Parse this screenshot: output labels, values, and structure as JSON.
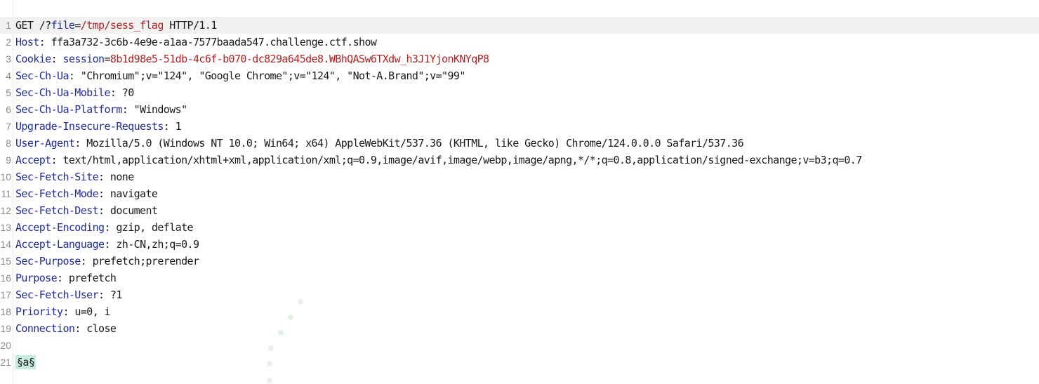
{
  "request": {
    "lines": [
      {
        "num": "1",
        "parts": [
          {
            "cls": "tok-val",
            "text": "GET /?"
          },
          {
            "cls": "tok-param",
            "text": "file"
          },
          {
            "cls": "tok-val",
            "text": "="
          },
          {
            "cls": "tok-red",
            "text": "/tmp/sess_flag"
          },
          {
            "cls": "tok-val",
            "text": " HTTP/1.1"
          }
        ]
      },
      {
        "num": "2",
        "parts": [
          {
            "cls": "tok-key",
            "text": "Host"
          },
          {
            "cls": "tok-sep",
            "text": ": "
          },
          {
            "cls": "tok-val",
            "text": "ffa3a732-3c6b-4e9e-a1aa-7577baada547.challenge.ctf.show"
          }
        ]
      },
      {
        "num": "3",
        "parts": [
          {
            "cls": "tok-key",
            "text": "Cookie"
          },
          {
            "cls": "tok-sep",
            "text": ": "
          },
          {
            "cls": "tok-param",
            "text": "session"
          },
          {
            "cls": "tok-val",
            "text": "="
          },
          {
            "cls": "tok-red",
            "text": "8b1d98e5-51db-4c6f-b070-dc829a645de8.WBhQASw6TXdw_h3J1YjonKNYqP8"
          }
        ]
      },
      {
        "num": "4",
        "parts": [
          {
            "cls": "tok-key",
            "text": "Sec-Ch-Ua"
          },
          {
            "cls": "tok-sep",
            "text": ": "
          },
          {
            "cls": "tok-val",
            "text": "\"Chromium\";v=\"124\", \"Google Chrome\";v=\"124\", \"Not-A.Brand\";v=\"99\""
          }
        ]
      },
      {
        "num": "5",
        "parts": [
          {
            "cls": "tok-key",
            "text": "Sec-Ch-Ua-Mobile"
          },
          {
            "cls": "tok-sep",
            "text": ": "
          },
          {
            "cls": "tok-val",
            "text": "?0"
          }
        ]
      },
      {
        "num": "6",
        "parts": [
          {
            "cls": "tok-key",
            "text": "Sec-Ch-Ua-Platform"
          },
          {
            "cls": "tok-sep",
            "text": ": "
          },
          {
            "cls": "tok-val",
            "text": "\"Windows\""
          }
        ]
      },
      {
        "num": "7",
        "parts": [
          {
            "cls": "tok-key",
            "text": "Upgrade-Insecure-Requests"
          },
          {
            "cls": "tok-sep",
            "text": ": "
          },
          {
            "cls": "tok-val",
            "text": "1"
          }
        ]
      },
      {
        "num": "8",
        "parts": [
          {
            "cls": "tok-key",
            "text": "User-Agent"
          },
          {
            "cls": "tok-sep",
            "text": ": "
          },
          {
            "cls": "tok-val",
            "text": "Mozilla/5.0 (Windows NT 10.0; Win64; x64) AppleWebKit/537.36 (KHTML, like Gecko) Chrome/124.0.0.0 Safari/537.36"
          }
        ]
      },
      {
        "num": "9",
        "parts": [
          {
            "cls": "tok-key",
            "text": "Accept"
          },
          {
            "cls": "tok-sep",
            "text": ": "
          },
          {
            "cls": "tok-val",
            "text": "text/html,application/xhtml+xml,application/xml;q=0.9,image/avif,image/webp,image/apng,*/*;q=0.8,application/signed-exchange;v=b3;q=0.7"
          }
        ]
      },
      {
        "num": "10",
        "parts": [
          {
            "cls": "tok-key",
            "text": "Sec-Fetch-Site"
          },
          {
            "cls": "tok-sep",
            "text": ": "
          },
          {
            "cls": "tok-val",
            "text": "none"
          }
        ]
      },
      {
        "num": "11",
        "parts": [
          {
            "cls": "tok-key",
            "text": "Sec-Fetch-Mode"
          },
          {
            "cls": "tok-sep",
            "text": ": "
          },
          {
            "cls": "tok-val",
            "text": "navigate"
          }
        ]
      },
      {
        "num": "12",
        "parts": [
          {
            "cls": "tok-key",
            "text": "Sec-Fetch-Dest"
          },
          {
            "cls": "tok-sep",
            "text": ": "
          },
          {
            "cls": "tok-val",
            "text": "document"
          }
        ]
      },
      {
        "num": "13",
        "parts": [
          {
            "cls": "tok-key",
            "text": "Accept-Encoding"
          },
          {
            "cls": "tok-sep",
            "text": ": "
          },
          {
            "cls": "tok-val",
            "text": "gzip, deflate"
          }
        ]
      },
      {
        "num": "14",
        "parts": [
          {
            "cls": "tok-key",
            "text": "Accept-Language"
          },
          {
            "cls": "tok-sep",
            "text": ": "
          },
          {
            "cls": "tok-val",
            "text": "zh-CN,zh;q=0.9"
          }
        ]
      },
      {
        "num": "15",
        "parts": [
          {
            "cls": "tok-key",
            "text": "Sec-Purpose"
          },
          {
            "cls": "tok-sep",
            "text": ": "
          },
          {
            "cls": "tok-val",
            "text": "prefetch;prerender"
          }
        ]
      },
      {
        "num": "16",
        "parts": [
          {
            "cls": "tok-key",
            "text": "Purpose"
          },
          {
            "cls": "tok-sep",
            "text": ": "
          },
          {
            "cls": "tok-val",
            "text": "prefetch"
          }
        ]
      },
      {
        "num": "17",
        "parts": [
          {
            "cls": "tok-key",
            "text": "Sec-Fetch-User"
          },
          {
            "cls": "tok-sep",
            "text": ": "
          },
          {
            "cls": "tok-val",
            "text": "?1"
          }
        ]
      },
      {
        "num": "18",
        "parts": [
          {
            "cls": "tok-key",
            "text": "Priority"
          },
          {
            "cls": "tok-sep",
            "text": ": "
          },
          {
            "cls": "tok-val",
            "text": "u=0, i"
          }
        ]
      },
      {
        "num": "19",
        "parts": [
          {
            "cls": "tok-key",
            "text": "Connection"
          },
          {
            "cls": "tok-sep",
            "text": ": "
          },
          {
            "cls": "tok-val",
            "text": "close"
          }
        ]
      },
      {
        "num": "20",
        "parts": []
      },
      {
        "num": "21",
        "parts": [
          {
            "cls": "payload",
            "text": "§a§"
          }
        ]
      }
    ]
  },
  "colors": {
    "header_key": "#1f2d9b",
    "highlight_red": "#b22222",
    "payload_marker_bg": "#c7ecdf",
    "current_line_bg": "#f1f1f1"
  }
}
